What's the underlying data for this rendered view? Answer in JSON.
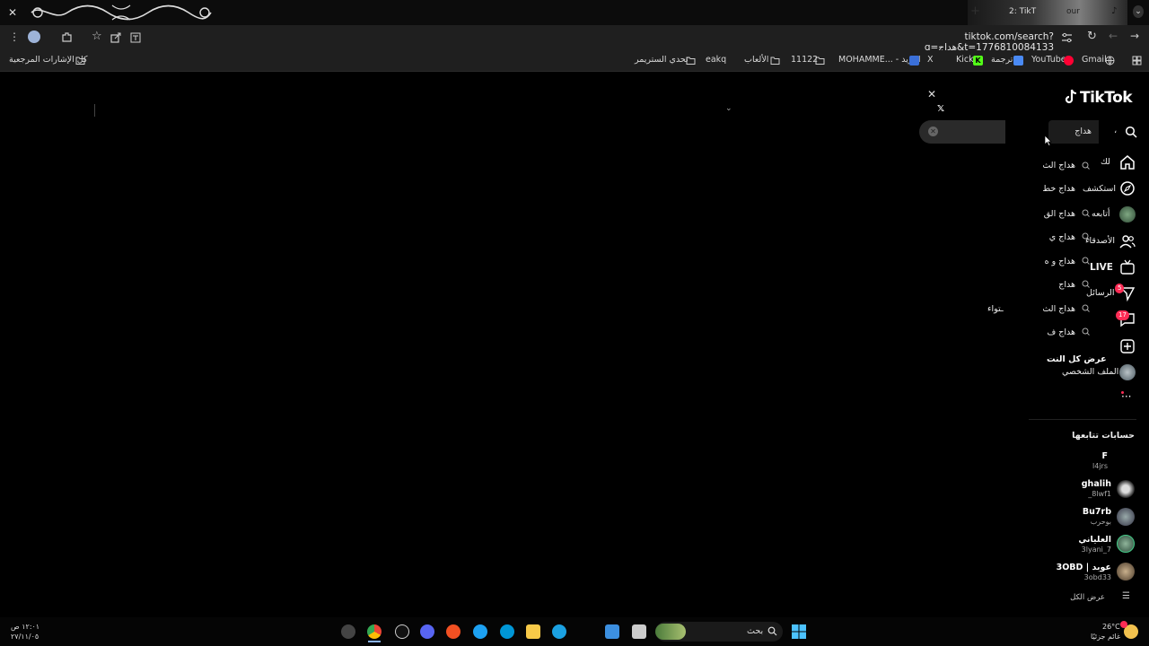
{
  "browser": {
    "tab_title": "TikT",
    "tab_title_prefix": "2",
    "tab_extra": "our",
    "url": "tiktok.com/search?q=هداج&t=1776810084133",
    "bookmarks": [
      "كل الإشارات المرجعية",
      "تحدي الستريمر",
      "eakq",
      "الألعاب",
      "11122",
      "MOHAMME... - البريد",
      "X",
      "Kick",
      "ترجمة",
      "YouTube",
      "Gmail"
    ]
  },
  "tiktok": {
    "logo": "TikTok",
    "search_value": "هداج",
    "search_cut_char": "،",
    "suggestions": [
      "هداج الث",
      "هداج خط",
      "هداج الق",
      "هداج ي",
      "هداج و ه",
      "هداج",
      "هداج الث",
      "هداج ف"
    ],
    "view_all": "عرض كل النت",
    "stray_text": "ـتواء",
    "nav": {
      "home": "لك",
      "explore": "استكشف",
      "following": "أتابعه",
      "friends": "الأصدقاء",
      "live": "LIVE",
      "messages": "الرسائل",
      "messages_badge": "5",
      "activity_badge": "17",
      "profile": "الملف الشخصي"
    },
    "following_section": {
      "title": "حسابات تتابعها",
      "accounts": [
        {
          "name": "F",
          "user": "l4jrs"
        },
        {
          "name": "ghalih",
          "user": "_8lwf1"
        },
        {
          "name": "Bu7rb",
          "user": "بوحرب"
        },
        {
          "name": "العلياني",
          "user": "3lyani_7"
        },
        {
          "name": "3OBD | عوبد",
          "user": "3obd33"
        }
      ],
      "see_all": "عرض الكل"
    }
  },
  "taskbar": {
    "time": "١٢:٠١ ص",
    "date": "٢٧/١١/٠٥",
    "search_placeholder": "بحث",
    "weather_temp": "26°C",
    "weather_desc": "غائم جزئيًا"
  },
  "colors": {
    "accent": "#fe2c55",
    "background": "#000000",
    "chrome": "#1f1f1f"
  }
}
